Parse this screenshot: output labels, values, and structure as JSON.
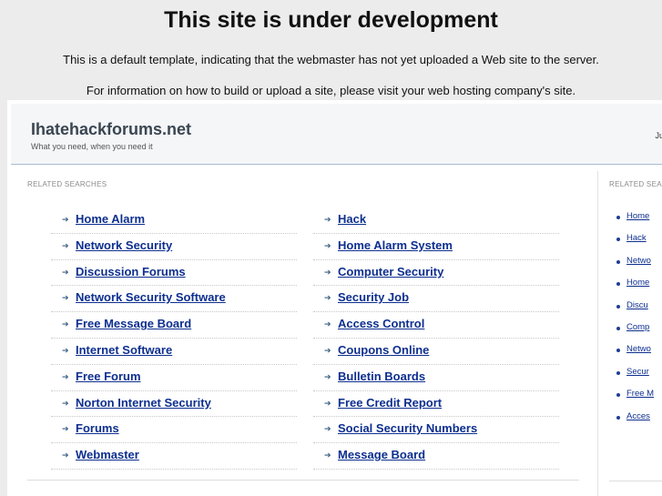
{
  "notice": {
    "title": "This site is under development",
    "line1": "This is a default template, indicating that the webmaster has not yet uploaded a Web site to the server.",
    "line2": "For information on how to build or upload a site, please visit your web hosting company's site."
  },
  "header": {
    "site_name": "Ihatehackforums.net",
    "tagline": "What you need, when you need it",
    "right_text": "Ju"
  },
  "main": {
    "section_label": "RELATED SEARCHES",
    "left_links": [
      "Home Alarm",
      "Network Security",
      "Discussion Forums",
      "Network Security Software",
      "Free Message Board",
      "Internet Software",
      "Free Forum",
      "Norton Internet Security",
      "Forums",
      "Webmaster"
    ],
    "right_links": [
      "Hack",
      "Home Alarm System",
      "Computer Security",
      "Security Job",
      "Access Control",
      "Coupons Online",
      "Bulletin Boards",
      "Free Credit Report",
      "Social Security Numbers",
      "Message Board"
    ]
  },
  "sidebar": {
    "section_label": "RELATED SEA",
    "links": [
      "Home",
      "Hack",
      "Netwo",
      "Home",
      "Discu",
      "Comp",
      "Netwo",
      "Secur",
      "Free M",
      "Acces"
    ]
  }
}
